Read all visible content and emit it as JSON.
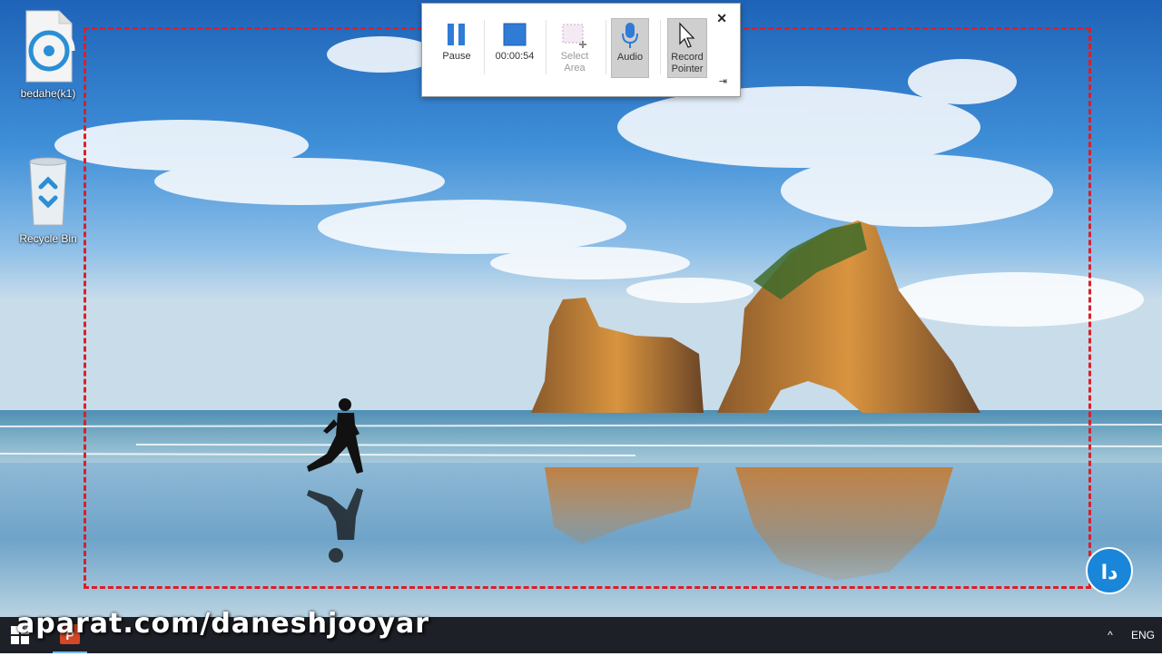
{
  "desktop": {
    "icons": [
      {
        "label": "bedahe(k1)",
        "icon": "document-disc-icon"
      },
      {
        "label": "Recycle Bin",
        "icon": "recycle-bin-icon"
      }
    ]
  },
  "toolbar": {
    "pause_label": "Pause",
    "timer": "00:00:54",
    "select_area_label": "Select Area",
    "audio_label": "Audio",
    "record_pointer_label": "Record Pointer",
    "close_glyph": "✕",
    "pin_glyph": "⇥"
  },
  "taskbar": {
    "tray_chevron": "^",
    "language": "ENG"
  },
  "watermark": {
    "text": "aparat.com/daneshjooyar",
    "logo_text": "دا"
  },
  "colors": {
    "record_border": "#d8202a",
    "toolbar_accent": "#2f7bd6",
    "taskbar": "#1d2027"
  }
}
